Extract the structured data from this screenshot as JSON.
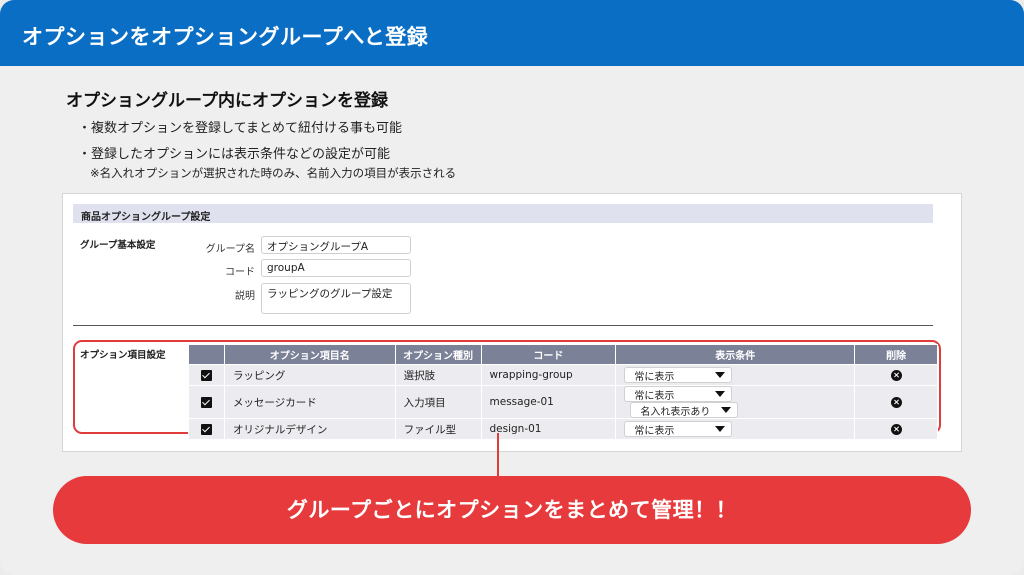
{
  "header": {
    "title": "オプションをオプショングループへと登録"
  },
  "intro": {
    "subtitle": "オプショングループ内にオプションを登録",
    "bullets": [
      "・複数オプションを登録してまとめて紐付ける事も可能",
      "・登録したオプションには表示条件などの設定が可能"
    ],
    "note": "※名入れオプションが選択された時のみ、名前入力の項目が表示される"
  },
  "panel": {
    "title": "商品オプショングループ設定",
    "basic_section": "グループ基本設定",
    "fields": [
      {
        "label": "グループ名",
        "value": "オプショングループA"
      },
      {
        "label": "コード",
        "value": "groupA"
      },
      {
        "label": "説明",
        "value": "ラッピングのグループ設定"
      }
    ],
    "options_section": "オプション項目設定",
    "table": {
      "headers": [
        "",
        "オプション項目名",
        "オプション種別",
        "コード",
        "表示条件",
        "削除"
      ],
      "rows": [
        {
          "checked": true,
          "name": "ラッピング",
          "type": "選択肢",
          "code": "wrapping-group",
          "conditions": [
            "常に表示"
          ]
        },
        {
          "checked": true,
          "name": "メッセージカード",
          "type": "入力項目",
          "code": "message-01",
          "conditions": [
            "常に表示",
            "名入れ表示あり"
          ]
        },
        {
          "checked": true,
          "name": "オリジナルデザイン",
          "type": "ファイル型",
          "code": "design-01",
          "conditions": [
            "常に表示"
          ]
        }
      ]
    }
  },
  "banner": {
    "text": "グループごとにオプションをまとめて管理！！"
  },
  "colors": {
    "header": "#0a6ec4",
    "accent": "#e63a3c",
    "table_header": "#7b8197"
  }
}
